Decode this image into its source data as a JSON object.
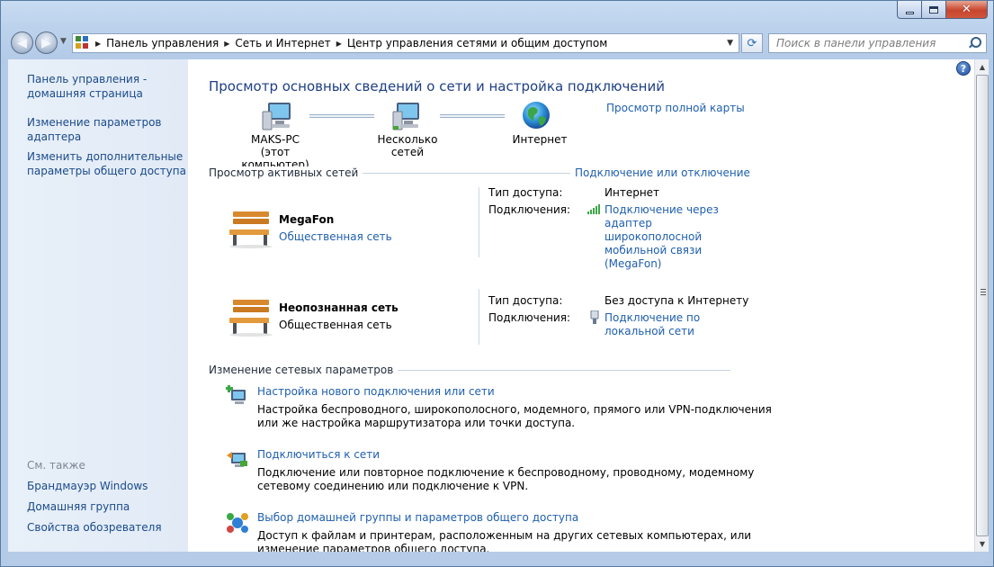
{
  "window": {
    "minimize_icon": "minimize-icon",
    "maximize_icon": "maximize-icon",
    "close_glyph": "✕"
  },
  "nav": {
    "breadcrumb": [
      "Панель управления",
      "Сеть и Интернет",
      "Центр управления сетями и общим доступом"
    ],
    "search_placeholder": "Поиск в панели управления"
  },
  "sidebar": {
    "links": [
      "Панель управления -",
      "домашняя страница",
      "Изменение параметров",
      "адаптера",
      "Изменить дополнительные",
      "параметры общего доступа"
    ],
    "see_also_title": "См. также",
    "see_also": [
      "Брандмауэр Windows",
      "Домашняя группа",
      "Свойства обозревателя"
    ]
  },
  "main": {
    "title": "Просмотр основных сведений о сети и настройка подключений",
    "view_full_map": "Просмотр полной карты",
    "map": {
      "computer_name": "MAKS-PC",
      "computer_sub": "(этот компьютер)",
      "networks": "Несколько сетей",
      "internet": "Интернет"
    },
    "active_title": "Просмотр активных сетей",
    "connect_disconnect": "Подключение или отключение",
    "access_label": "Тип доступа:",
    "connections_label": "Подключения:",
    "active_networks": [
      {
        "name": "MegaFon",
        "category": "Общественная сеть",
        "access": "Интернет",
        "connection": [
          "Подключение через",
          "адаптер",
          "широкополосной",
          "мобильной связи",
          "(MegaFon)"
        ]
      },
      {
        "name": "Неопознанная сеть",
        "category": "Общественная сеть",
        "access": "Без доступа к Интернету",
        "connection": [
          "Подключение по",
          "локальной сети"
        ]
      }
    ],
    "change_title": "Изменение сетевых параметров",
    "tasks": [
      {
        "title": "Настройка нового подключения или сети",
        "desc": [
          "Настройка беспроводного, широкополосного, модемного, прямого или VPN-подключения",
          "или же настройка маршрутизатора или точки доступа."
        ]
      },
      {
        "title": "Подключиться к сети",
        "desc": [
          "Подключение или повторное подключение к беспроводному, проводному, модемному",
          "сетевому соединению или подключение к VPN."
        ]
      },
      {
        "title": "Выбор домашней группы и параметров общего доступа",
        "desc": [
          "Доступ к файлам и принтерам, расположенным на других сетевых компьютерах, или",
          "изменение параметров общего доступа."
        ]
      }
    ]
  },
  "colors": {
    "link": "#1f5fae",
    "title": "#1e3f83",
    "sidebar_bg": "#e4edf8"
  }
}
